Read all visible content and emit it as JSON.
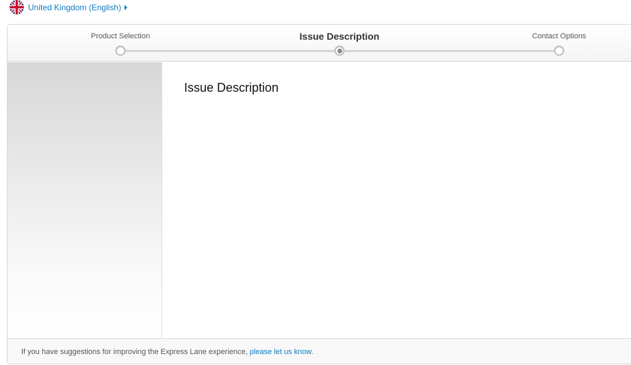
{
  "locale": {
    "label": "United Kingdom (English)",
    "flag_icon": "uk-flag-icon"
  },
  "stepper": {
    "steps": [
      {
        "label": "Product Selection",
        "state": "completed"
      },
      {
        "label": "Issue Description",
        "state": "active"
      },
      {
        "label": "Contact Options",
        "state": "pending"
      }
    ]
  },
  "content": {
    "title": "Issue Description"
  },
  "footer": {
    "text_before": "If you have suggestions for improving the Express Lane experience, ",
    "link": "please let us know",
    "text_after": "."
  },
  "colors": {
    "link": "#0d7cc1",
    "border": "#d6d6d6"
  }
}
